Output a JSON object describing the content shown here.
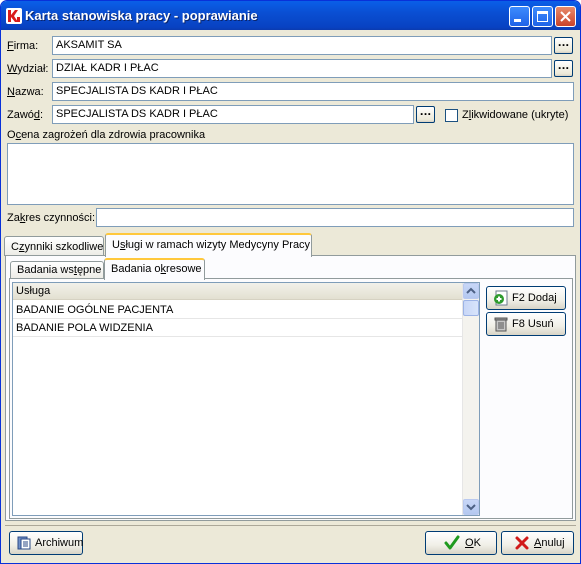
{
  "window": {
    "title": "Karta stanowiska pracy - poprawianie"
  },
  "form": {
    "firma_label_u": "F",
    "firma_label_rest": "irma:",
    "firma_value": "AKSAMIT SA",
    "wydzial_label_u": "W",
    "wydzial_label_rest": "ydział:",
    "wydzial_value": "DZIAŁ KADR I PŁAC",
    "nazwa_label_u": "N",
    "nazwa_label_rest": "azwa:",
    "nazwa_value": "SPECJALISTA DS KADR I PŁAC",
    "zawod_label_pre": "Zawó",
    "zawod_label_u": "d",
    "zawod_label_rest": ":",
    "zawod_value": "SPECJALISTA DS KADR I PŁAC",
    "zlikwidowane_pre": "Z",
    "zlikwidowane_u": "l",
    "zlikwidowane_rest": "ikwidowane (ukryte)",
    "ocena_pre": "O",
    "ocena_u": "c",
    "ocena_rest": "ena zagrożeń dla zdrowia pracownika",
    "zakres_pre": "Za",
    "zakres_u": "k",
    "zakres_rest": "res czynności:",
    "zakres_value": "",
    "browse_label": "..."
  },
  "tabs": {
    "outer": [
      {
        "pre": "C",
        "u": "z",
        "rest": "ynniki szkodliwe"
      },
      {
        "pre": "U",
        "u": "s",
        "rest": "ługi w ramach wizyty Medycyny Pracy"
      }
    ],
    "inner": [
      {
        "pre": "Badania ws",
        "u": "t",
        "rest": "ępne"
      },
      {
        "pre": "Badania o",
        "u": "k",
        "rest": "resowe"
      }
    ]
  },
  "grid": {
    "header": "Usługa",
    "rows": [
      "BADANIE OGÓLNE PACJENTA",
      "BADANIE POLA WIDZENIA"
    ]
  },
  "side_buttons": {
    "add": "F2 Dodaj",
    "remove": "F8 Usuń"
  },
  "footer": {
    "archiwum": "Archiwum",
    "ok_pre": "",
    "ok_u": "O",
    "ok_rest": "K",
    "cancel_u": "A",
    "cancel_rest": "nuluj"
  },
  "colors": {
    "titlebar": "#0a4fd3",
    "dialog_bg": "#ece9d8",
    "tab_highlight": "#ffc83c",
    "field_border": "#7f9db9"
  }
}
